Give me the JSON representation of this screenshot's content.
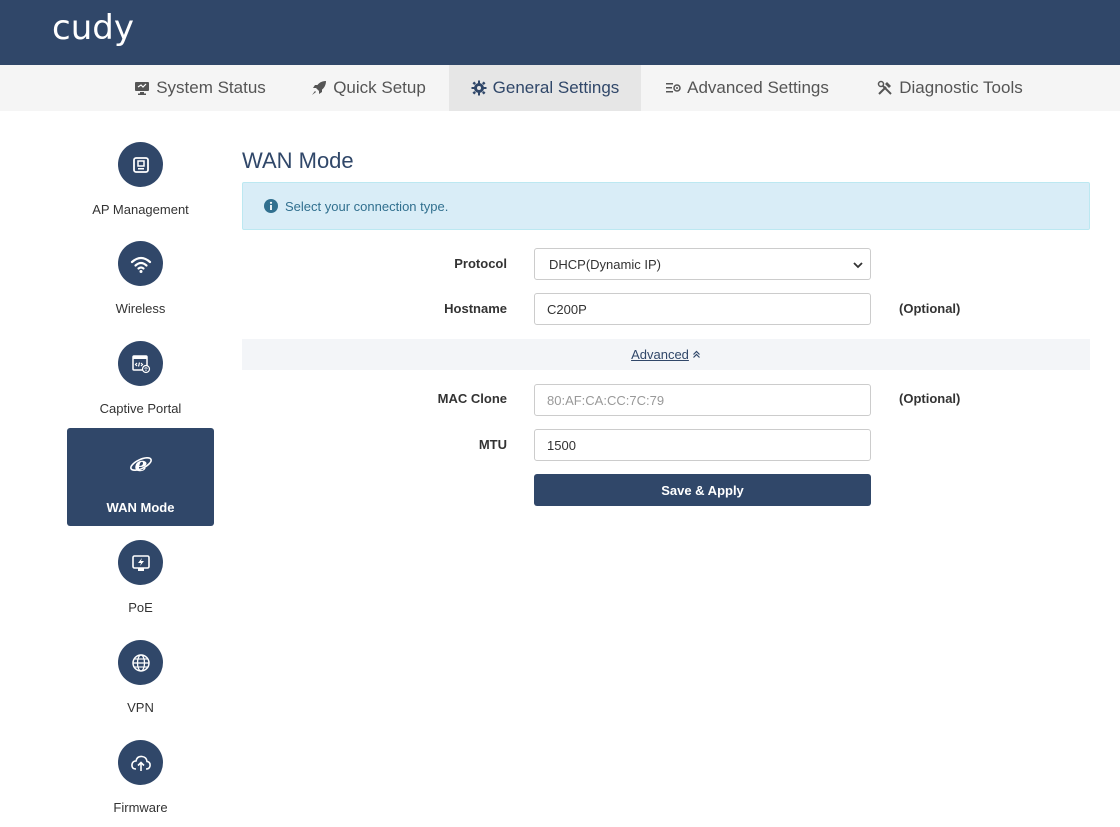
{
  "brand": {
    "logo_text": "cudy"
  },
  "topnav": {
    "tabs": [
      {
        "label": "System Status",
        "icon": "monitor-icon"
      },
      {
        "label": "Quick Setup",
        "icon": "rocket-icon"
      },
      {
        "label": "General Settings",
        "icon": "gear-icon",
        "active": true
      },
      {
        "label": "Advanced Settings",
        "icon": "sliders-icon"
      },
      {
        "label": "Diagnostic Tools",
        "icon": "tools-icon"
      }
    ]
  },
  "sidebar": {
    "items": [
      {
        "label": "AP Management",
        "icon": "ap-device-icon"
      },
      {
        "label": "Wireless",
        "icon": "wifi-icon"
      },
      {
        "label": "Captive Portal",
        "icon": "captive-portal-icon"
      },
      {
        "label": "WAN Mode",
        "icon": "internet-explorer-icon",
        "active": true
      },
      {
        "label": "PoE",
        "icon": "poe-icon"
      },
      {
        "label": "VPN",
        "icon": "globe-icon"
      },
      {
        "label": "Firmware",
        "icon": "cloud-upload-icon"
      }
    ]
  },
  "main": {
    "title": "WAN Mode",
    "info": "Select your connection type.",
    "protocol": {
      "label": "Protocol",
      "value": "DHCP(Dynamic IP)"
    },
    "hostname": {
      "label": "Hostname",
      "value": "C200P",
      "hint": "(Optional)"
    },
    "advanced": {
      "label": "Advanced"
    },
    "mac_clone": {
      "label": "MAC Clone",
      "placeholder": "80:AF:CA:CC:7C:79",
      "hint": "(Optional)"
    },
    "mtu": {
      "label": "MTU",
      "value": "1500"
    },
    "save_label": "Save & Apply"
  },
  "colors": {
    "primary": "#304769",
    "info_bg": "#d9edf7",
    "info_text": "#31708f"
  }
}
